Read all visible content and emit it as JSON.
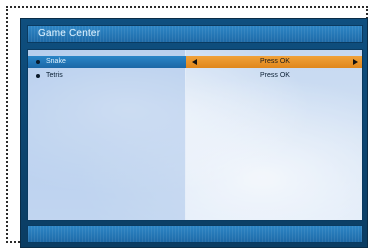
{
  "window": {
    "title": "Game Center"
  },
  "games": [
    {
      "name": "Snake",
      "action": "Press OK",
      "selected": true
    },
    {
      "name": "Tetris",
      "action": "Press OK",
      "selected": false
    }
  ],
  "colors": {
    "title_bar": "#2e86c6",
    "selected_left": "#2a85c7",
    "selected_right": "#f0a13a",
    "background_top": "#b9d0ee",
    "background_bottom": "#d7e5f6"
  },
  "icons": {
    "bullet": "bullet-icon",
    "left_arrow": "triangle-left-icon",
    "right_arrow": "triangle-right-icon"
  }
}
